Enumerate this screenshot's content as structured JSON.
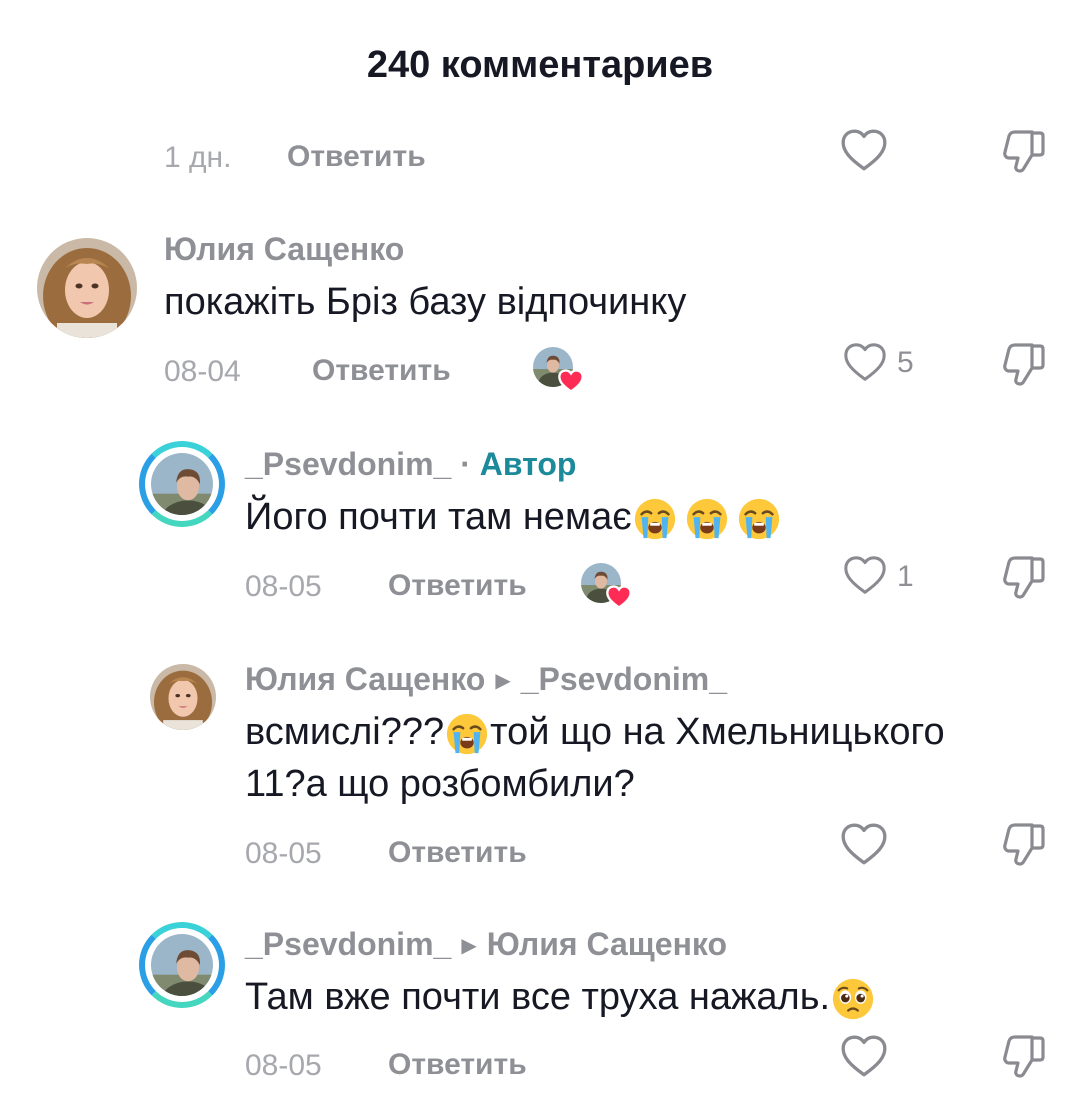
{
  "header": {
    "title": "240 комментариев"
  },
  "labels": {
    "reply": "Ответить",
    "author_tag": "Автор",
    "separator": " · "
  },
  "icons": {
    "like": "heart-outline-icon",
    "dislike": "thumb-down-outline-icon",
    "reply_arrow": "caret-right-icon",
    "liked_by": "heart-filled-icon"
  },
  "colors": {
    "author_accent": "#1c8a9a",
    "heart_badge": "#fe2c55",
    "ring": "#2a9fe6"
  },
  "comments": [
    {
      "time": "1 дн."
    },
    {
      "user": "Юлия Сащенко",
      "text": "покажіть Бріз базу відпочинку",
      "time": "08-04",
      "likes": "5"
    },
    {
      "user": "_Psevdonim_",
      "text": "Його почти там немає",
      "time": "08-05",
      "likes": "1"
    },
    {
      "user": "Юлия Сащенко",
      "reply_to": "_Psevdonim_",
      "text_a": "всмислі???",
      "text_b": "той що на Хмельницького",
      "text_c": "11?а що розбомбили?",
      "time": "08-05"
    },
    {
      "user": "_Psevdonim_",
      "reply_to": "Юлия Сащенко",
      "text": "Там вже почти все труха нажаль.",
      "time": "08-05"
    }
  ]
}
